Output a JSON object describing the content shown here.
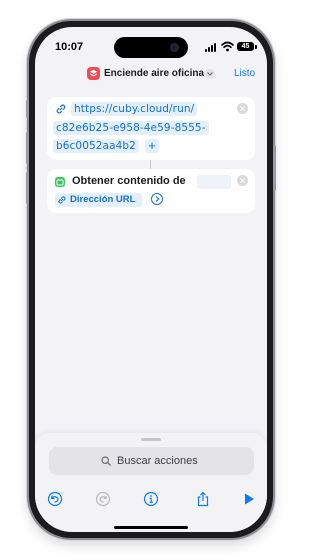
{
  "status_bar": {
    "time": "10:07",
    "battery": "45"
  },
  "nav": {
    "title": "Enciende aire oficina",
    "done_label": "Listo",
    "accent_color": "#0a7aff",
    "app_icon": "layers-icon"
  },
  "actions": [
    {
      "type": "url",
      "icon": "link-icon",
      "url_lines": [
        "https://cuby.cloud/run/",
        "c82e6b25-e958-4e59-8555-",
        "b6c0052aa4b2"
      ],
      "add_button": "+"
    },
    {
      "type": "get-contents",
      "icon": "app-icon",
      "title": "Obtener contenido de",
      "parameter_label": "Dirección URL",
      "parameter_icon": "link-icon"
    }
  ],
  "bottom_sheet": {
    "search_placeholder": "Buscar acciones",
    "toolbar_icons": [
      "undo-icon",
      "redo-icon",
      "info-icon",
      "share-icon",
      "play-icon"
    ]
  }
}
